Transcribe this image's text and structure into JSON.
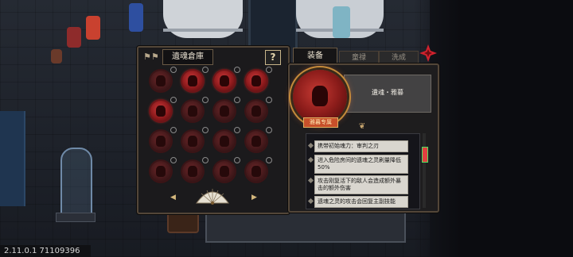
{
  "version": "2.11.0.1 71109396",
  "warehouse": {
    "title": "遺魂倉庫",
    "help_label": "?",
    "slots": [
      {
        "state": "off"
      },
      {
        "state": "on"
      },
      {
        "state": "on"
      },
      {
        "state": "on"
      },
      {
        "state": "on"
      },
      {
        "state": "off"
      },
      {
        "state": "off"
      },
      {
        "state": "off"
      },
      {
        "state": "off"
      },
      {
        "state": "off"
      },
      {
        "state": "off"
      },
      {
        "state": "off"
      },
      {
        "state": "off"
      },
      {
        "state": "off"
      },
      {
        "state": "off"
      },
      {
        "state": "off"
      }
    ]
  },
  "details": {
    "tabs": {
      "equip": "装备",
      "second": "童禄",
      "third": "洗成"
    },
    "soul_name": "遺魂・雅暮",
    "badge": "雅暮专属",
    "effects": [
      "携带初始魂力：审判之刃",
      "进入危险房间的遗魂之灵刷量降低50%",
      "攻击刚复活下的敌人会造成额外暴击的额外伤害",
      "遗魂之灵的攻击会回复主副技能"
    ]
  },
  "colors": {
    "accent": "#c63a33",
    "frame": "#534638",
    "gold": "#c8a670"
  }
}
